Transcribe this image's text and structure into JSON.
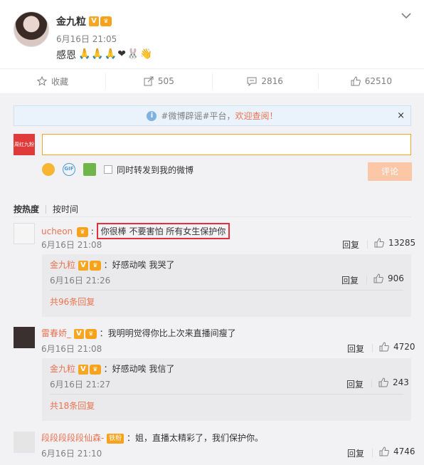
{
  "post": {
    "author": "金九粒",
    "time": "6月16日 21:05",
    "text": "感恩",
    "emojis": "🙏🙏🙏❤🐰👋"
  },
  "actions": {
    "favorite": "收藏",
    "repost": "505",
    "comment": "2816",
    "like": "62510"
  },
  "notice": {
    "prefix": "#微博辟谣#平台，",
    "link": "欢迎查阅！",
    "close": "×"
  },
  "composer": {
    "placeholder": "",
    "forward_label": "同时转发到我的微博",
    "submit": "评论",
    "gif_text": "GIF",
    "my_avatar_text": "周红九粉"
  },
  "sort": {
    "hot": "按热度",
    "time": "按时间"
  },
  "comments": [
    {
      "user": "ucheon",
      "text": "你很棒 不要害怕 所有女生保护你",
      "time": "6月16日 21:08",
      "reply": "回复",
      "likes": "13285",
      "sub": {
        "user": "金九粒",
        "text": "：好感动唉 我哭了",
        "time": "6月16日 21:26",
        "reply": "回复",
        "likes": "906",
        "more": "共96条回复"
      }
    },
    {
      "user": "雷春娇_",
      "text": "：我明明觉得你比上次来直播间瘦了",
      "time": "6月16日 21:08",
      "reply": "回复",
      "likes": "4720",
      "sub": {
        "user": "金九粒",
        "text": "：好感动唉 我信了",
        "time": "6月16日 21:27",
        "reply": "回复",
        "likes": "243",
        "more": "共18条回复"
      }
    },
    {
      "user": "段段段段段仙森-",
      "badge": "铁粉",
      "text": "：姐，直播太精彩了，我们保护你。",
      "time": "6月16日 21:10",
      "reply": "回复",
      "likes": "4746"
    }
  ],
  "colors": {
    "accent": "#eb7350",
    "highlight": "#e3303a",
    "input_border": "#f5a623",
    "submit_bg": "#fbc7a7"
  }
}
